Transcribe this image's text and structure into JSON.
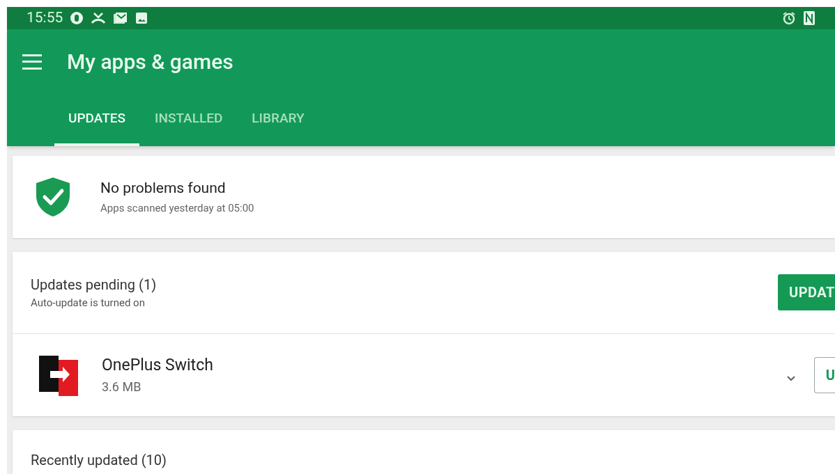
{
  "status_bar": {
    "time": "15:55"
  },
  "app_bar": {
    "title": "My apps & games"
  },
  "tabs": [
    {
      "label": "UPDATES",
      "selected": true
    },
    {
      "label": "INSTALLED",
      "selected": false
    },
    {
      "label": "LIBRARY",
      "selected": false
    }
  ],
  "security_card": {
    "title": "No problems found",
    "subtitle": "Apps scanned yesterday at 05:00"
  },
  "updates_card": {
    "title": "Updates pending (1)",
    "subtitle": "Auto-update is turned on",
    "button": "UPDAT",
    "apps": [
      {
        "name": "OnePlus Switch",
        "size": "3.6 MB",
        "button": "U"
      }
    ]
  },
  "recent_card": {
    "title": "Recently updated (10)"
  }
}
